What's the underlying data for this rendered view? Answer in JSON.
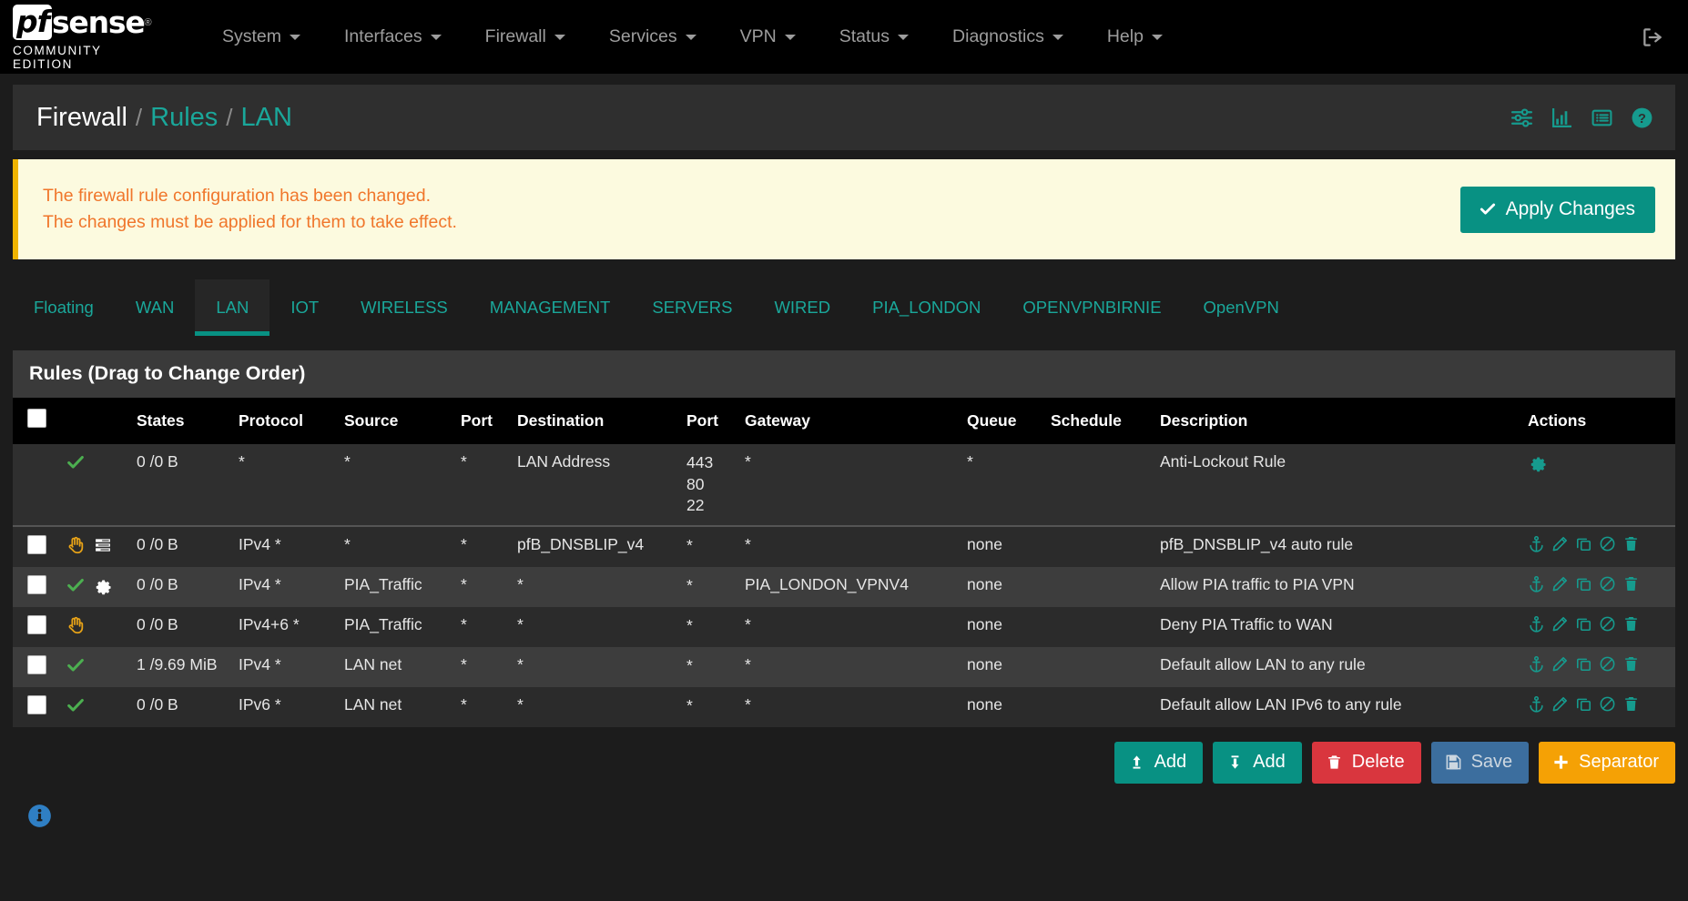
{
  "navbar": {
    "brand": {
      "pf": "pf",
      "sense": "sense",
      "edition": "COMMUNITY EDITION"
    },
    "items": [
      {
        "label": "System"
      },
      {
        "label": "Interfaces"
      },
      {
        "label": "Firewall"
      },
      {
        "label": "Services"
      },
      {
        "label": "VPN"
      },
      {
        "label": "Status"
      },
      {
        "label": "Diagnostics"
      },
      {
        "label": "Help"
      }
    ],
    "logout_icon": "sign-out-icon"
  },
  "page_header": {
    "breadcrumb": {
      "root": "Firewall",
      "sep": "/",
      "middle": "Rules",
      "current": "LAN"
    },
    "icons": [
      {
        "name": "sliders-icon"
      },
      {
        "name": "bar-chart-icon"
      },
      {
        "name": "list-table-icon"
      },
      {
        "name": "help-circle-icon"
      }
    ]
  },
  "alert": {
    "line1": "The firewall rule configuration has been changed.",
    "line2": "The changes must be applied for them to take effect.",
    "apply_label": "Apply Changes",
    "accent": "#f0762b",
    "button_color": "#089183"
  },
  "tabs": [
    {
      "label": "Floating",
      "active": false
    },
    {
      "label": "WAN",
      "active": false
    },
    {
      "label": "LAN",
      "active": true
    },
    {
      "label": "IOT",
      "active": false
    },
    {
      "label": "WIRELESS",
      "active": false
    },
    {
      "label": "MANAGEMENT",
      "active": false
    },
    {
      "label": "SERVERS",
      "active": false
    },
    {
      "label": "WIRED",
      "active": false
    },
    {
      "label": "PIA_LONDON",
      "active": false
    },
    {
      "label": "OPENVPNBIRNIE",
      "active": false
    },
    {
      "label": "OpenVPN",
      "active": false
    }
  ],
  "panel": {
    "title": "Rules (Drag to Change Order)",
    "columns": [
      "",
      "",
      "States",
      "Protocol",
      "Source",
      "Port",
      "Destination",
      "Port",
      "Gateway",
      "Queue",
      "Schedule",
      "Description",
      "Actions"
    ],
    "rows": [
      {
        "checkbox": false,
        "status": [
          "pass-check-icon"
        ],
        "states": "0 /0 B",
        "protocol": "*",
        "source": "*",
        "source_link": false,
        "port1": "*",
        "destination": "LAN Address",
        "destination_link": false,
        "port2": [
          "443",
          "80",
          "22"
        ],
        "gateway": "*",
        "queue": "*",
        "schedule": "",
        "description": "Anti-Lockout Rule",
        "actions": [
          "gear-icon"
        ]
      },
      {
        "checkbox": true,
        "status": [
          "block-hand-icon",
          "log-icon"
        ],
        "states": "0 /0 B",
        "protocol": "IPv4 *",
        "source": "*",
        "source_link": false,
        "port1": "*",
        "destination": "pfB_DNSBLIP_v4",
        "destination_link": true,
        "port2": [
          "*"
        ],
        "gateway": "*",
        "queue": "none",
        "schedule": "",
        "description": "pfB_DNSBLIP_v4 auto rule",
        "actions": [
          "anchor-icon",
          "edit-pencil-icon",
          "copy-icon",
          "disable-icon",
          "delete-trash-icon"
        ]
      },
      {
        "checkbox": true,
        "status": [
          "pass-check-icon",
          "gear-icon"
        ],
        "states": "0 /0 B",
        "protocol": "IPv4 *",
        "source": "PIA_Traffic",
        "source_link": true,
        "port1": "*",
        "destination": "*",
        "destination_link": false,
        "port2": [
          "*"
        ],
        "gateway": "PIA_LONDON_VPNV4",
        "queue": "none",
        "schedule": "",
        "description": "Allow PIA traffic to PIA VPN",
        "actions": [
          "anchor-icon",
          "edit-pencil-icon",
          "copy-icon",
          "disable-icon",
          "delete-trash-icon"
        ]
      },
      {
        "checkbox": true,
        "status": [
          "block-hand-icon"
        ],
        "states": "0 /0 B",
        "protocol": "IPv4+6 *",
        "source": "PIA_Traffic",
        "source_link": true,
        "port1": "*",
        "destination": "*",
        "destination_link": false,
        "port2": [
          "*"
        ],
        "gateway": "*",
        "queue": "none",
        "schedule": "",
        "description": "Deny PIA Traffic to WAN",
        "actions": [
          "anchor-icon",
          "edit-pencil-icon",
          "copy-icon",
          "disable-icon",
          "delete-trash-icon"
        ]
      },
      {
        "checkbox": true,
        "status": [
          "pass-check-icon"
        ],
        "states": "1 /9.69 MiB",
        "protocol": "IPv4 *",
        "source": "LAN net",
        "source_link": false,
        "port1": "*",
        "destination": "*",
        "destination_link": false,
        "port2": [
          "*"
        ],
        "gateway": "*",
        "queue": "none",
        "schedule": "",
        "description": "Default allow LAN to any rule",
        "actions": [
          "anchor-icon",
          "edit-pencil-icon",
          "copy-icon",
          "disable-icon",
          "delete-trash-icon"
        ]
      },
      {
        "checkbox": true,
        "status": [
          "pass-check-icon"
        ],
        "states": "0 /0 B",
        "protocol": "IPv6 *",
        "source": "LAN net",
        "source_link": false,
        "port1": "*",
        "destination": "*",
        "destination_link": false,
        "port2": [
          "*"
        ],
        "gateway": "*",
        "queue": "none",
        "schedule": "",
        "description": "Default allow LAN IPv6 to any rule",
        "actions": [
          "anchor-icon",
          "edit-pencil-icon",
          "copy-icon",
          "disable-icon",
          "delete-trash-icon"
        ]
      }
    ]
  },
  "buttons": [
    {
      "label": "Add",
      "icon": "arrow-up-icon",
      "color": "#089183"
    },
    {
      "label": "Add",
      "icon": "arrow-down-icon",
      "color": "#089183"
    },
    {
      "label": "Delete",
      "icon": "trash-icon",
      "color": "#d9363e"
    },
    {
      "label": "Save",
      "icon": "save-floppy-icon",
      "color": "#3c6e9e"
    },
    {
      "label": "Separator",
      "icon": "plus-icon",
      "color": "#f5a105"
    }
  ],
  "footer": {
    "info_icon": "info-circle-icon"
  }
}
